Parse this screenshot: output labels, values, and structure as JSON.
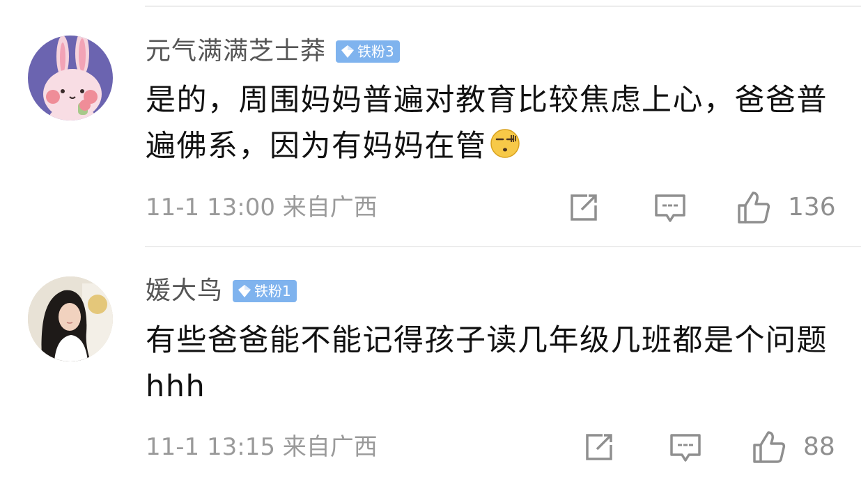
{
  "comments": [
    {
      "username": "元气满满芝士莽",
      "badge": "铁粉3",
      "text": "是的，周围妈妈普遍对教育比较焦虑上心，爸爸普遍佛系，因为有妈妈在管",
      "emoji": "smirk-face-emoji",
      "time": "11-1 13:00",
      "location": "来自广西",
      "likes": "136",
      "avatar": "bunny-avatar"
    },
    {
      "username": "媛大鸟",
      "badge": "铁粉1",
      "text": "有些爸爸能不能记得孩子读几年级几班都是个问题hhh",
      "time": "11-1 13:15",
      "location": "来自广西",
      "likes": "88",
      "avatar": "girl-photo-avatar"
    }
  ],
  "colors": {
    "badge": "#7fb3ee",
    "username": "#555555",
    "body": "#111111",
    "meta": "#9a9a9a",
    "icon": "#8f8f8f"
  }
}
